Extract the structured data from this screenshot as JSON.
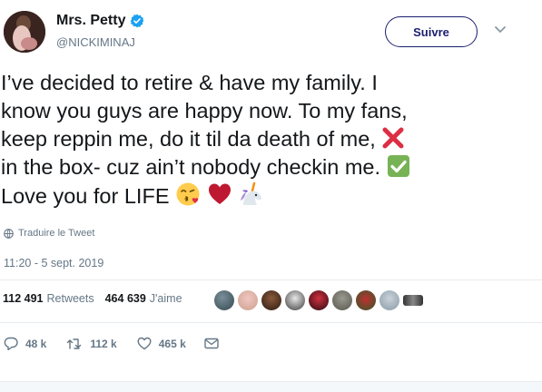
{
  "user": {
    "name": "Mrs. Petty",
    "handle": "@NICKIMINAJ"
  },
  "follow_label": "Suivre",
  "tweet": {
    "lines": [
      "I’ve decided to retire & have my family. I",
      "know you guys are happy now. To my fans,",
      "keep reppin me, do it til da death of me,",
      "in the box- cuz ain’t nobody checkin me.",
      "Love you for LIFE"
    ],
    "emoji": [
      "cross-mark",
      "check-mark",
      "kissing-face",
      "heart",
      "unicorn"
    ]
  },
  "translate_label": "Traduire le Tweet",
  "timestamp": "11:20 - 5 sept. 2019",
  "stats": {
    "retweets_count": "112 491",
    "retweets_label": "Retweets",
    "likes_count": "464 639",
    "likes_label": "J'aime"
  },
  "actions": {
    "replies": "48 k",
    "retweets": "112 k",
    "likes": "465 k"
  },
  "colors": {
    "accent": "#1b1f6e",
    "verified": "#1da1f2",
    "muted": "#657786",
    "text": "#14171a"
  }
}
